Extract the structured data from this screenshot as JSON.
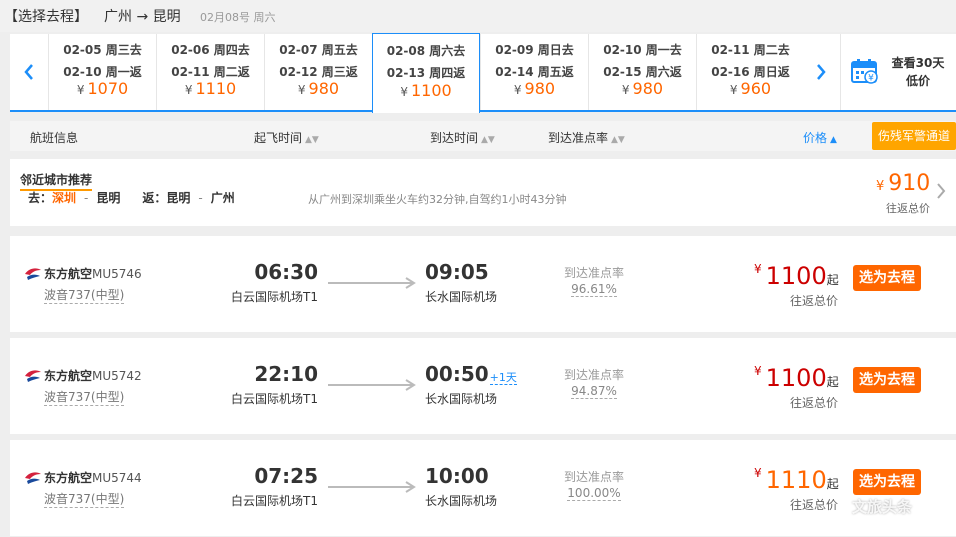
{
  "header": {
    "title": "【选择去程】",
    "route": "广州 → 昆明",
    "date": "02月08号 周六"
  },
  "colors": {
    "accent": "#1c8ef9",
    "orange": "#ff6600",
    "red": "#cc0000",
    "military": "#ffa500"
  },
  "dates": [
    {
      "go": "02-05 周三去",
      "ret": "02-10 周一返",
      "price": "1070",
      "active": false
    },
    {
      "go": "02-06 周四去",
      "ret": "02-11 周二返",
      "price": "1110",
      "active": false
    },
    {
      "go": "02-07 周五去",
      "ret": "02-12 周三返",
      "price": "980",
      "active": false
    },
    {
      "go": "02-08 周六去",
      "ret": "02-13 周四返",
      "price": "1100",
      "active": true
    },
    {
      "go": "02-09 周日去",
      "ret": "02-14 周五返",
      "price": "980",
      "active": false
    },
    {
      "go": "02-10 周一去",
      "ret": "02-15 周六返",
      "price": "980",
      "active": false
    },
    {
      "go": "02-11 周二去",
      "ret": "02-16 周日返",
      "price": "960",
      "active": false
    }
  ],
  "yen": "¥",
  "calendar": {
    "line1": "查看30天",
    "line2": "低价",
    "icon": "calendar-yen-icon"
  },
  "sort": {
    "flight_info": "航班信息",
    "dep_time": "起飞时间",
    "arr_time": "到达时间",
    "on_time": "到达准点率",
    "price": "价格",
    "military": "伤残军警通道"
  },
  "recommend": {
    "title": "邻近城市推荐",
    "go_label": "去：",
    "go_from": "深圳",
    "go_to": "昆明",
    "ret_label": "返：",
    "ret_from": "昆明",
    "ret_to": "广州",
    "note": "从广州到深圳乘坐火车约32分钟,自驾约1小时43分钟",
    "price": "910",
    "sub": "往返总价"
  },
  "flights": [
    {
      "airline": "东方航空",
      "flight_no": "MU5746",
      "plane": "波音737(中型)",
      "dep": "06:30",
      "dep_airport": "白云国际机场T1",
      "arr": "09:05",
      "plus": "",
      "arr_airport": "长水国际机场",
      "ontime_label": "到达准点率",
      "ontime": "96.61%",
      "price": "1100",
      "qi": "起",
      "sub": "往返总价",
      "select": "选为去程"
    },
    {
      "airline": "东方航空",
      "flight_no": "MU5742",
      "plane": "波音737(中型)",
      "dep": "22:10",
      "dep_airport": "白云国际机场T1",
      "arr": "00:50",
      "plus": "+1天",
      "arr_airport": "长水国际机场",
      "ontime_label": "到达准点率",
      "ontime": "94.87%",
      "price": "1100",
      "qi": "起",
      "sub": "往返总价",
      "select": "选为去程"
    },
    {
      "airline": "东方航空",
      "flight_no": "MU5744",
      "plane": "波音737(中型)",
      "dep": "07:25",
      "dep_airport": "白云国际机场T1",
      "arr": "10:00",
      "plus": "",
      "arr_airport": "长水国际机场",
      "ontime_label": "到达准点率",
      "ontime": "100.00%",
      "price": "1110",
      "qi": "起",
      "sub": "往返总价",
      "select": "选为去程"
    }
  ],
  "watermark": "文旅头条"
}
